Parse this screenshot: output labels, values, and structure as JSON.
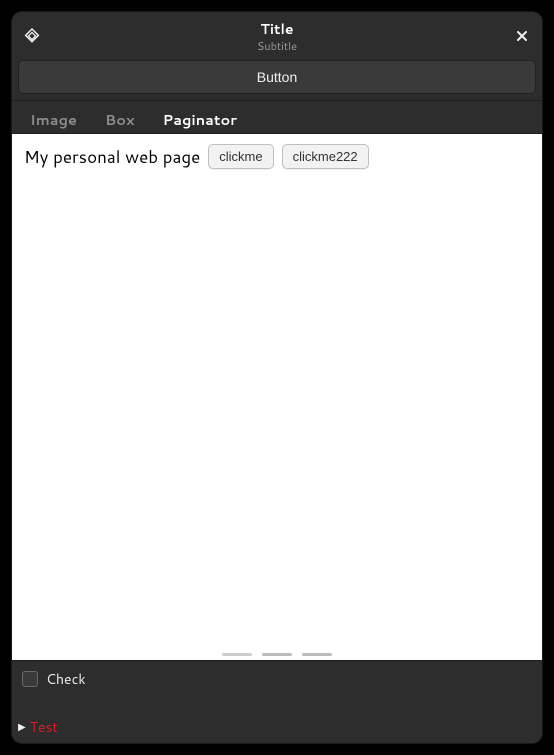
{
  "header": {
    "title": "Title",
    "subtitle": "Subtitle"
  },
  "top_button": {
    "label": "Button"
  },
  "tabs": [
    {
      "label": "Image",
      "active": false
    },
    {
      "label": "Box",
      "active": false
    },
    {
      "label": "Paginator",
      "active": true
    }
  ],
  "content": {
    "text": "My personal web page",
    "buttons": [
      "clickme",
      "clickme222"
    ],
    "page_indicator": {
      "count": 3,
      "active": 0
    }
  },
  "bottom": {
    "check_label": "Check",
    "expander_label": "Test"
  }
}
